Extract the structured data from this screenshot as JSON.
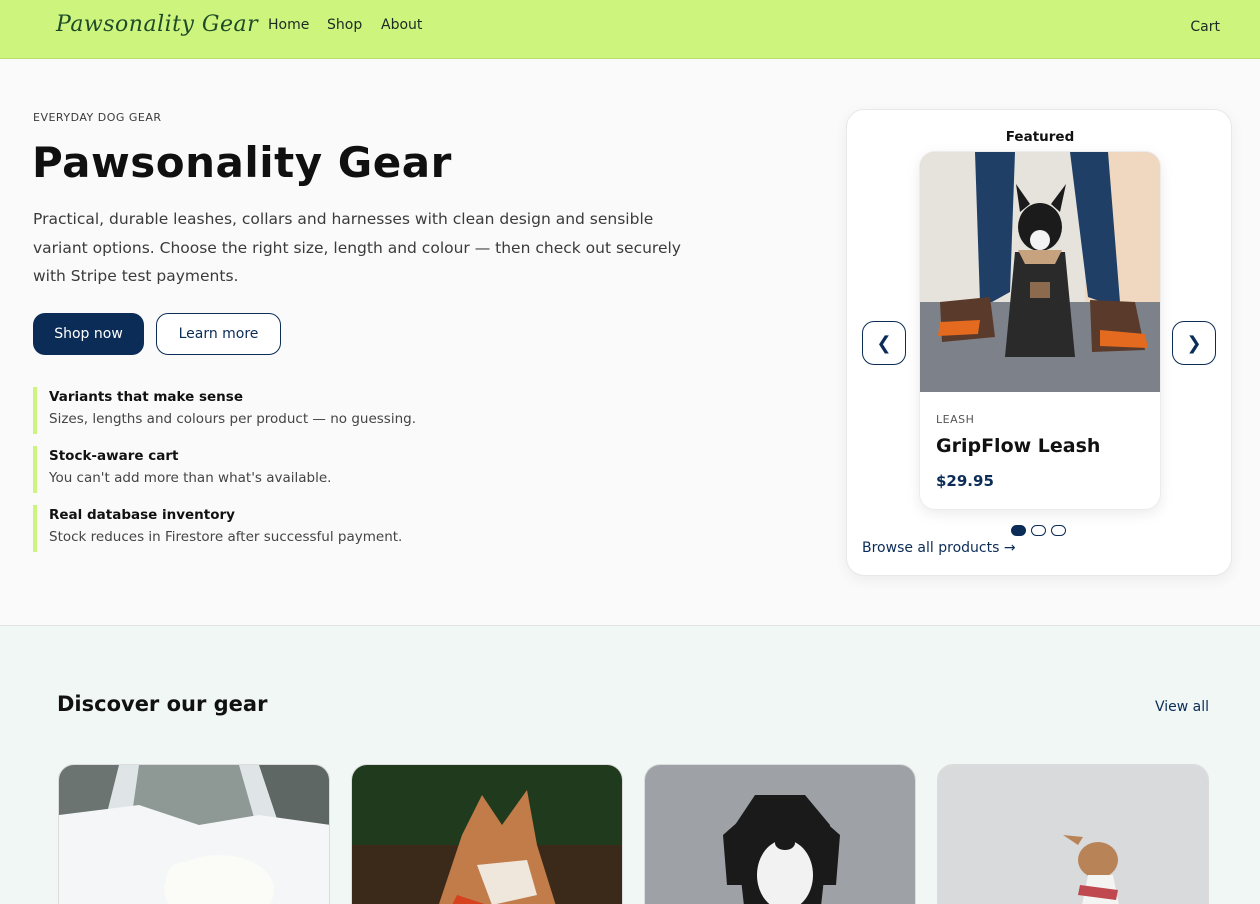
{
  "nav": {
    "logo": "Pawsonality Gear",
    "links": [
      "Home",
      "Shop",
      "About"
    ],
    "cart": "Cart"
  },
  "hero": {
    "eyebrow": "EVERYDAY DOG GEAR",
    "title": "Pawsonality Gear",
    "description": "Practical, durable leashes, collars and harnesses with clean design and sensible variant options. Choose the right size, length and colour — then check out securely with Stripe test payments.",
    "primary_button": "Shop now",
    "secondary_button": "Learn more",
    "features": [
      {
        "title": "Variants that make sense",
        "text": "Sizes, lengths and colours per product — no guessing."
      },
      {
        "title": "Stock-aware cart",
        "text": "You can't add more than what's available."
      },
      {
        "title": "Real database inventory",
        "text": "Stock reduces in Firestore after successful payment."
      }
    ]
  },
  "featured": {
    "label": "Featured",
    "prev_icon": "❮",
    "next_icon": "❯",
    "product": {
      "category": "LEASH",
      "name": "GripFlow Leash",
      "price": "$29.95"
    },
    "slides": 3,
    "active_slide": 1,
    "browse_link": "Browse all products →"
  },
  "discover": {
    "title": "Discover our gear",
    "view_all": "View all"
  },
  "colors": {
    "nav_bg": "#cdf57d",
    "primary": "#0b2c57",
    "accent_border": "#cdf57d",
    "section_bg": "#f0f7f5"
  }
}
